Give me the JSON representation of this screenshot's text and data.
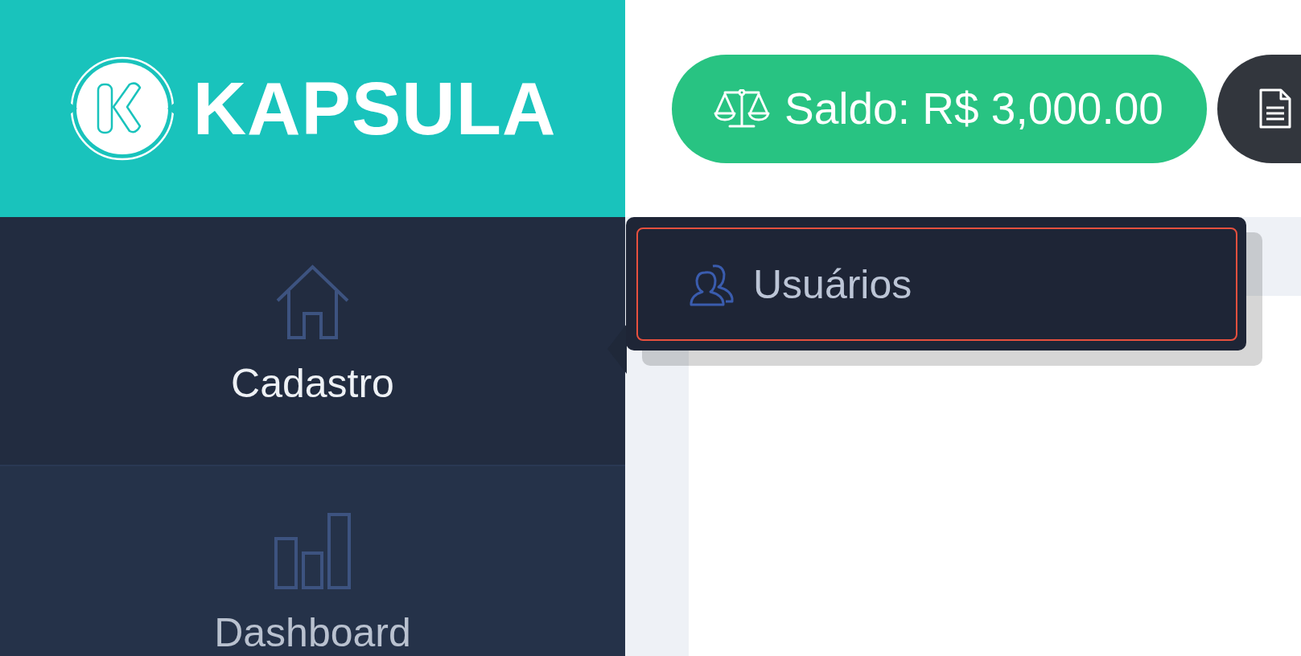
{
  "logo": {
    "text": "KAPSULA"
  },
  "header": {
    "balance_button": {
      "label": "Saldo: R$ 3,000.00"
    }
  },
  "sidebar": {
    "items": [
      {
        "label": "Cadastro",
        "selected": true
      },
      {
        "label": "Dashboard",
        "selected": false
      }
    ]
  },
  "dropdown": {
    "items": [
      {
        "label": "Usuários",
        "selected": true
      }
    ]
  }
}
